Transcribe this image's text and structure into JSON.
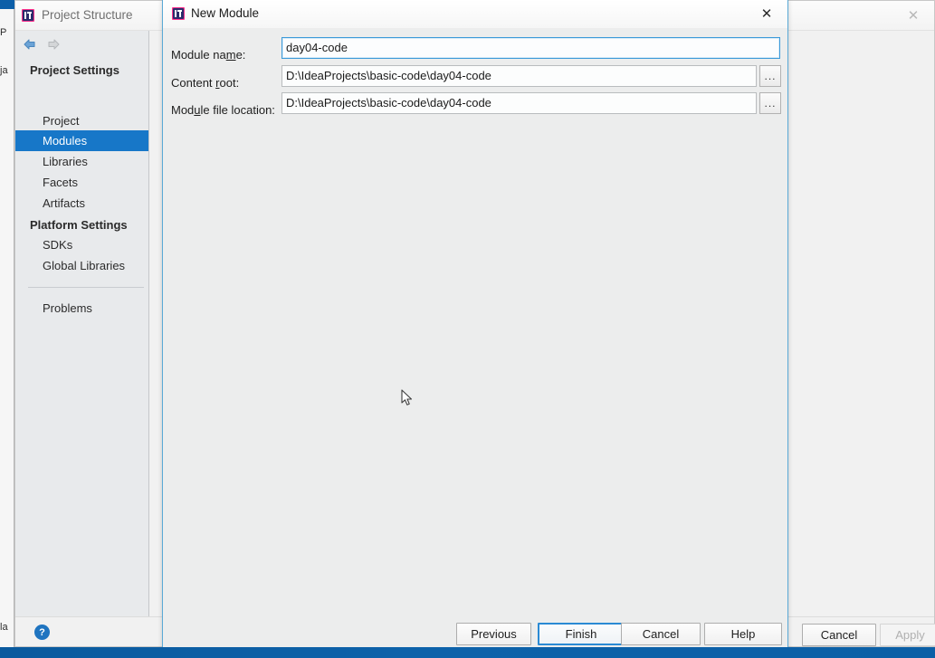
{
  "background_window": {
    "title": "Project Structure",
    "title_icon": "intellij-idea-icon",
    "close_icon": "close-icon",
    "nav": {
      "back_icon": "arrow-left-icon",
      "forward_icon": "arrow-right-icon",
      "add_icon": "plus-icon"
    },
    "groups": [
      {
        "label": "Project Settings"
      },
      {
        "label": "Platform Settings"
      }
    ],
    "items": [
      {
        "label": "Project",
        "selected": false
      },
      {
        "label": "Modules",
        "selected": true
      },
      {
        "label": "Libraries",
        "selected": false
      },
      {
        "label": "Facets",
        "selected": false
      },
      {
        "label": "Artifacts",
        "selected": false
      },
      {
        "label": "SDKs",
        "selected": false
      },
      {
        "label": "Global Libraries",
        "selected": false
      },
      {
        "label": "Problems",
        "selected": false
      }
    ],
    "help_icon_label": "?",
    "buttons": {
      "cancel": "Cancel",
      "apply": "Apply"
    }
  },
  "ide_fragments": {
    "frag_top": "P",
    "frag_mid": "ja",
    "frag_bottom": "la"
  },
  "dialog": {
    "title": "New Module",
    "title_icon": "intellij-idea-icon",
    "close_icon": "close-icon",
    "fields": [
      {
        "label_before": "Module na",
        "label_mnemonic": "m",
        "label_after": "e:",
        "value": "day04-code",
        "focused": true,
        "has_browse": false
      },
      {
        "label_before": "Content ",
        "label_mnemonic": "r",
        "label_after": "oot:",
        "value": "D:\\IdeaProjects\\basic-code\\day04-code",
        "focused": false,
        "has_browse": true,
        "browse_label": "..."
      },
      {
        "label_before": "Mod",
        "label_mnemonic": "u",
        "label_after": "le file location:",
        "value": "D:\\IdeaProjects\\basic-code\\day04-code",
        "focused": false,
        "has_browse": true,
        "browse_label": "..."
      }
    ],
    "buttons": {
      "previous": "Previous",
      "finish": "Finish",
      "cancel": "Cancel",
      "help": "Help"
    }
  },
  "colors": {
    "selection_blue": "#1777c8",
    "dialog_border_blue": "#5aa9d6",
    "focus_blue": "#3c9ad9",
    "taskbar_blue": "#0d62aa",
    "dialog_bg": "#eceded",
    "nav_bg": "#e8eaec"
  }
}
